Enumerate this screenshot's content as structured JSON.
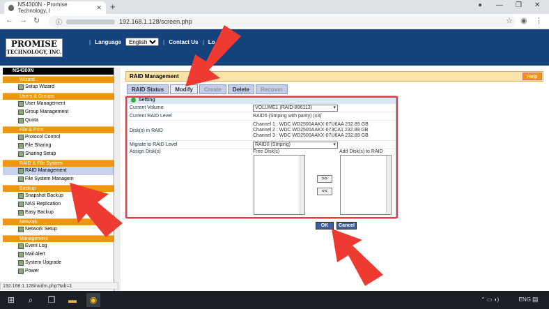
{
  "browser": {
    "tab_title": "NS4300N - Promise Technology, I",
    "url": "192.168.1.128/screen.php",
    "new_tab": "+",
    "status_url": "192.168.1.128/raidm.php?tab=1"
  },
  "header": {
    "logo_line1": "PROMISE",
    "logo_line2": "TECHNOLOGY, INC.",
    "language_label": "Language",
    "language_value": "English",
    "contact": "Contact Us",
    "logout": "Lo"
  },
  "sidebar": {
    "device": "NS4300N",
    "groups": [
      {
        "label": "Wizard",
        "items": [
          "Setup Wizard"
        ]
      },
      {
        "label": "Users & Groups",
        "items": [
          "User Management",
          "Group Management",
          "Quota"
        ]
      },
      {
        "label": "File & Print",
        "items": [
          "Protocol Control",
          "File Sharing",
          "Sharing Setup"
        ]
      },
      {
        "label": "RAID & File System",
        "items": [
          "RAID Management",
          "File System Managem"
        ]
      },
      {
        "label": "Backup",
        "items": [
          "Snapshot Backup",
          "NAS Replication",
          "Easy Backup"
        ]
      },
      {
        "label": "Network",
        "items": [
          "Network Setup"
        ]
      },
      {
        "label": "Management",
        "items": [
          "Event Log",
          "Mail Alert",
          "System Upgrade",
          "Power"
        ]
      }
    ]
  },
  "main": {
    "title": "RAID Management",
    "help": "Help",
    "tabs": [
      "RAID Status",
      "Modify",
      "Create",
      "Delete",
      "Recover"
    ],
    "section": "Setting",
    "current_volume_label": "Current Volume",
    "current_volume": "VOLUME1 (RAID-896113)",
    "current_level_label": "Current RAID Level",
    "current_level": "RAID5 (Striping with parity) (x3)",
    "disks_label": "Disk(s) in RAID",
    "disks": [
      "Channel 1 : WDC WD2500AAKX-07U6AA 232.89 GB",
      "Channel 2 : WDC WD2500AAKX-073CA1 232.89 GB",
      "Channel 3 : WDC WD2500AAKX-07U6AA 232.89 GB"
    ],
    "migrate_label": "Migrate to RAID Level",
    "migrate_value": "RAID0 (Striping)",
    "assign_label": "Assign Disk(s)",
    "free_label": "Free Disk(s)",
    "add_label": "Add Disk(s) to RAID",
    "move_right": ">>",
    "move_left": "<<",
    "ok": "OK",
    "cancel": "Cancel"
  },
  "taskbar": {
    "lang": "ENG"
  },
  "colors": {
    "header": "#15427c",
    "orange": "#f0950f",
    "arrow": "#ee3a30"
  }
}
